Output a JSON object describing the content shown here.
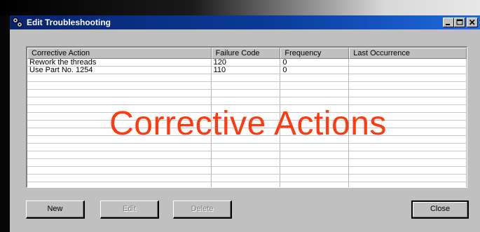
{
  "window": {
    "title": "Edit Troubleshooting",
    "minimize_icon": "minimize-icon",
    "maximize_icon": "maximize-icon",
    "close_icon": "close-icon",
    "app_icon": "gears-icon"
  },
  "table": {
    "columns": [
      "Corrective Action",
      "Failure Code",
      "Frequency",
      "Last Occurrence"
    ],
    "rows": [
      [
        "Rework the threads",
        "120",
        "0",
        ""
      ],
      [
        "Use Part No. 1254",
        "110",
        "0",
        ""
      ]
    ],
    "empty_rows": 15
  },
  "overlay_text": "Corrective Actions",
  "buttons": {
    "new": "New",
    "edit": "Edit",
    "delete": "Delete",
    "close": "Close"
  },
  "colors": {
    "title_bar": "#08246b",
    "overlay": "#ff3a10",
    "window": "#c0c0c0"
  }
}
